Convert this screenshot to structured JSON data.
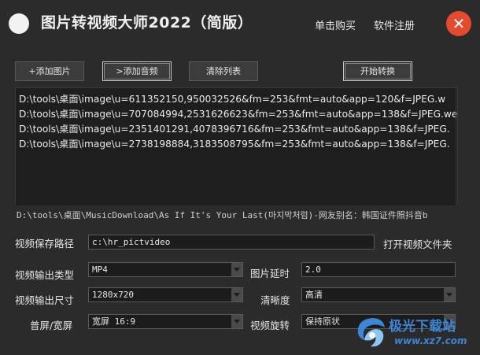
{
  "header": {
    "title": "图片转视频大师2022（简版）",
    "buy_label": "单击购买",
    "register_label": "软件注册",
    "close_glyph": "✕"
  },
  "toolbar": {
    "add_image": "+添加图片",
    "add_audio": ">添加音频",
    "clear_list": "清除列表",
    "start_convert": "开始转换"
  },
  "file_list": [
    "D:\\tools\\桌面\\image\\u=611352150,950032526&fm=253&fmt=auto&app=120&f=JPEG.w",
    "D:\\tools\\桌面\\image\\u=707084994,2531626623&fm=253&fmt=auto&app=138&f=JPEG.we",
    "D:\\tools\\桌面\\image\\u=2351401291,4078396716&fm=253&fmt=auto&app=138&f=JPEG.",
    "D:\\tools\\桌面\\image\\u=2738198884,3183508795&fm=253&fmt=auto&app=138&f=JPEG."
  ],
  "audio_path": "D:\\tools\\桌面\\MusicDownload\\As  If  It's  Your  Last(마지막처럼)-网友别名：韩国证件照抖音b",
  "settings": {
    "save_path_label": "视频保存路径",
    "save_path_value": "c:\\hr_pictvideo",
    "open_folder_label": "打开视频文件夹",
    "output_type_label": "视频输出类型",
    "output_type_value": "MP4",
    "delay_label": "图片延时",
    "delay_value": "2.0",
    "output_size_label": "视频输出尺寸",
    "output_size_value": "1280x720",
    "clarity_label": "清晰度",
    "clarity_value": "高清",
    "aspect_label": "普屏/宽屏",
    "aspect_value": "宽屏 16:9",
    "rotate_label": "视频旋转",
    "rotate_value": "保持原状"
  },
  "watermark": {
    "brand_text": "极光下载站",
    "url_text": "www.xz7.com"
  },
  "colors": {
    "background": "#2b2b2b",
    "close_button": "#e64a2e",
    "list_background": "#1e1e1e",
    "watermark_blue": "#3d86d6"
  }
}
